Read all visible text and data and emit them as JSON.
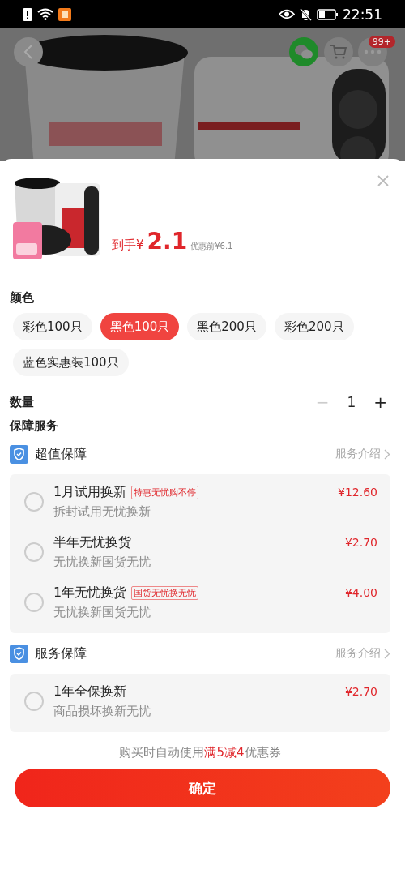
{
  "status_bar": {
    "time": "22:51"
  },
  "header": {
    "more_badge": "99+"
  },
  "product": {
    "price_prefix": "到手¥",
    "price": "2.1",
    "original_price": "优惠前¥6.1"
  },
  "color_section": {
    "title": "颜色",
    "options": [
      {
        "label": "彩色100只",
        "selected": false
      },
      {
        "label": "黑色100只",
        "selected": true
      },
      {
        "label": "黑色200只",
        "selected": false
      },
      {
        "label": "彩色200只",
        "selected": false
      },
      {
        "label": "蓝色实惠装100只",
        "selected": false
      }
    ]
  },
  "quantity": {
    "label": "数量",
    "minus": "−",
    "value": "1",
    "plus": "+",
    "minus_disabled": true
  },
  "services_title": "保障服务",
  "service_groups": [
    {
      "title": "超值保障",
      "link": "服务介绍",
      "items": [
        {
          "name": "1月试用换新",
          "tag": "特惠无忧购不停",
          "desc": "拆封试用无忧换新",
          "price": "¥12.60",
          "selected": false
        },
        {
          "name": "半年无忧换货",
          "desc": "无忧换新国货无忧",
          "price": "¥2.70",
          "selected": false
        },
        {
          "name": "1年无忧换货",
          "tag": "国货无忧换无忧",
          "desc": "无忧换新国货无忧",
          "price": "¥4.00",
          "selected": false
        }
      ]
    },
    {
      "title": "服务保障",
      "link": "服务介绍",
      "items": [
        {
          "name": "1年全保换新",
          "desc": "商品损坏换新无忧",
          "price": "¥2.70",
          "selected": false
        }
      ]
    }
  ],
  "coupon_note": "购买时自动使用**满5减4**优惠券",
  "confirm_button": "确定"
}
